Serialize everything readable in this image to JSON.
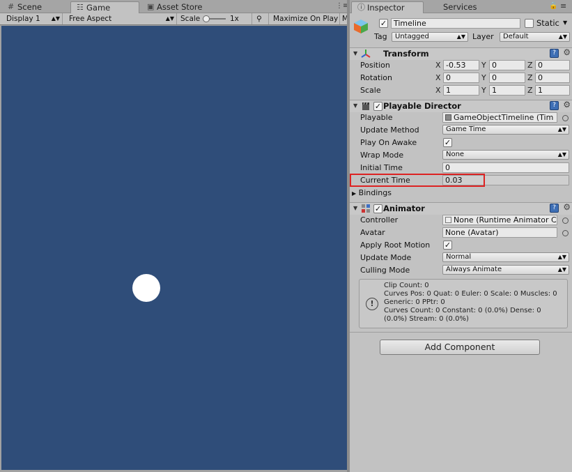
{
  "left_tabs": [
    {
      "label": "Scene",
      "icon": "scene-grid-icon"
    },
    {
      "label": "Game",
      "icon": "game-controller-icon",
      "active": true
    },
    {
      "label": "Asset Store",
      "icon": "asset-store-icon"
    }
  ],
  "game_toolbar": {
    "display": "Display 1",
    "aspect": "Free Aspect",
    "scale_label": "Scale",
    "scale_value": "1x",
    "maximize": "Maximize On Play",
    "overflow": "M"
  },
  "game_view": {
    "background": "#2f4d79",
    "ball_color": "#ffffff"
  },
  "right_tabs": [
    {
      "label": "Inspector",
      "icon": "inspector-info-icon",
      "active": true
    },
    {
      "label": "Services"
    }
  ],
  "window_controls": {
    "lock": "lock-icon",
    "menu": "tab-menu-icon"
  },
  "object": {
    "name": "Timeline",
    "static_label": "Static",
    "tag_label": "Tag",
    "tag_value": "Untagged",
    "layer_label": "Layer",
    "layer_value": "Default"
  },
  "transform": {
    "title": "Transform",
    "rows": [
      {
        "label": "Position",
        "x": "-0.53",
        "y": "0",
        "z": "0"
      },
      {
        "label": "Rotation",
        "x": "0",
        "y": "0",
        "z": "0"
      },
      {
        "label": "Scale",
        "x": "1",
        "y": "1",
        "z": "1"
      }
    ],
    "axes": [
      "X",
      "Y",
      "Z"
    ]
  },
  "playable_director": {
    "title": "Playable Director",
    "playable_label": "Playable",
    "playable_value": "GameObjectTimeline (Tim",
    "update_method_label": "Update Method",
    "update_method_value": "Game Time",
    "play_on_awake_label": "Play On Awake",
    "wrap_mode_label": "Wrap Mode",
    "wrap_mode_value": "None",
    "initial_time_label": "Initial Time",
    "initial_time_value": "0",
    "current_time_label": "Current Time",
    "current_time_value": "0.03",
    "bindings_label": "Bindings"
  },
  "animator": {
    "title": "Animator",
    "controller_label": "Controller",
    "controller_value": "None (Runtime Animator C",
    "avatar_label": "Avatar",
    "avatar_value": "None (Avatar)",
    "apply_root_motion_label": "Apply Root Motion",
    "update_mode_label": "Update Mode",
    "update_mode_value": "Normal",
    "culling_mode_label": "Culling Mode",
    "culling_mode_value": "Always Animate",
    "info": "Clip Count: 0\nCurves Pos: 0 Quat: 0 Euler: 0 Scale: 0 Muscles: 0\nGeneric: 0 PPtr: 0\nCurves Count: 0 Constant: 0 (0.0%) Dense: 0\n(0.0%) Stream: 0 (0.0%)"
  },
  "add_component": "Add Component",
  "highlight_color": "#dd2222"
}
